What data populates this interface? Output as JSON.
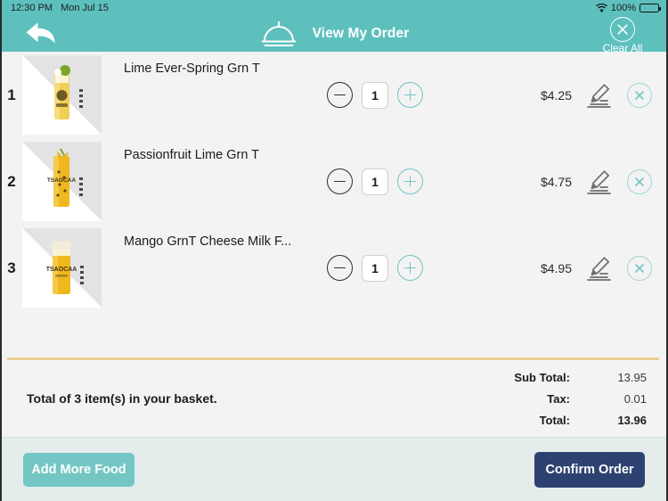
{
  "status_bar": {
    "time": "12:30 PM",
    "date": "Mon Jul 15",
    "battery_percent": "100%",
    "wifi_icon": "wifi-icon",
    "battery_icon": "battery-icon"
  },
  "header": {
    "back_icon": "back-arrow-icon",
    "brand_icon": "cloche-icon",
    "title": "View My Order",
    "clear_all_icon": "circle-x-icon",
    "clear_all_label": "Clear All"
  },
  "order_items": [
    {
      "index": "1",
      "name": "Lime Ever-Spring Grn T",
      "quantity": "1",
      "price": "$4.25",
      "thumbnail_icon": "lime-green-tea-cup-image",
      "decrease_icon": "minus-circle-icon",
      "increase_icon": "plus-circle-icon",
      "edit_icon": "pencil-edit-icon",
      "delete_icon": "circle-x-icon"
    },
    {
      "index": "2",
      "name": "Passionfruit Lime Grn T",
      "quantity": "1",
      "price": "$4.75",
      "thumbnail_icon": "passionfruit-lime-tea-cup-image",
      "decrease_icon": "minus-circle-icon",
      "increase_icon": "plus-circle-icon",
      "edit_icon": "pencil-edit-icon",
      "delete_icon": "circle-x-icon"
    },
    {
      "index": "3",
      "name": "Mango GrnT Cheese Milk F...",
      "quantity": "1",
      "price": "$4.95",
      "thumbnail_icon": "mango-cheese-milk-foam-cup-image",
      "decrease_icon": "minus-circle-icon",
      "increase_icon": "plus-circle-icon",
      "edit_icon": "pencil-edit-icon",
      "delete_icon": "circle-x-icon"
    }
  ],
  "summary": {
    "basket_text": "Total of 3 item(s) in your basket.",
    "sub_total_label": "Sub Total:",
    "sub_total_value": "13.95",
    "tax_label": "Tax:",
    "tax_value": "0.01",
    "total_label": "Total:",
    "total_value": "13.96"
  },
  "actions": {
    "add_more_label": "Add More Food",
    "confirm_label": "Confirm Order"
  },
  "colors": {
    "header_teal": "#5dc0bd",
    "accent_teal": "#74c3c4",
    "confirm_navy": "#2e4272",
    "add_more_teal": "#73c6c3",
    "divider_gold": "#e8cf8e",
    "page_bg": "#f3f3f4",
    "action_bar_bg": "#e4ecec"
  }
}
